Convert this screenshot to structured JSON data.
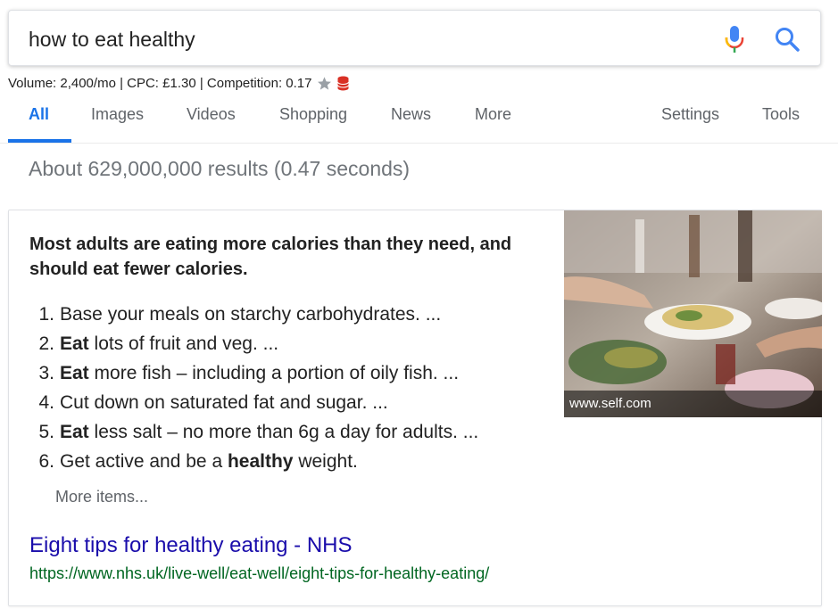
{
  "search": {
    "query": "how to eat healthy"
  },
  "seo_bar": {
    "text": "Volume: 2,400/mo | CPC: £1.30 | Competition: 0.17"
  },
  "tabs": {
    "items": [
      {
        "label": "All",
        "active": true
      },
      {
        "label": "Images"
      },
      {
        "label": "Videos"
      },
      {
        "label": "Shopping"
      },
      {
        "label": "News"
      },
      {
        "label": "More"
      }
    ],
    "settings_label": "Settings",
    "tools_label": "Tools"
  },
  "result_stats": "About 629,000,000 results (0.47 seconds)",
  "snippet": {
    "heading": "Most adults are eating more calories than they need, and should eat fewer calories.",
    "items": [
      {
        "num": "1.",
        "pre": "",
        "bold": "",
        "text": "Base your meals on starchy carbohydrates. ..."
      },
      {
        "num": "2.",
        "pre": "",
        "bold": "Eat",
        "text": " lots of fruit and veg. ..."
      },
      {
        "num": "3.",
        "pre": "",
        "bold": "Eat",
        "text": " more fish – including a portion of oily fish. ..."
      },
      {
        "num": "4.",
        "pre": "",
        "bold": "",
        "text": "Cut down on saturated fat and sugar. ..."
      },
      {
        "num": "5.",
        "pre": "",
        "bold": "Eat",
        "text": " less salt – no more than 6g a day for adults. ..."
      },
      {
        "num": "6.",
        "pre": "Get active and be a ",
        "bold": "healthy",
        "text": " weight."
      }
    ],
    "more_items": "More items...",
    "result_title": "Eight tips for healthy eating - NHS",
    "result_url": "https://www.nhs.uk/live-well/eat-well/eight-tips-for-healthy-eating/",
    "image_caption": "www.self.com"
  },
  "colors": {
    "accent": "#1a73e8",
    "link": "#1a0dab",
    "url": "#006621"
  },
  "icons": [
    "mic-icon",
    "search-icon",
    "star-icon",
    "database-icon"
  ]
}
